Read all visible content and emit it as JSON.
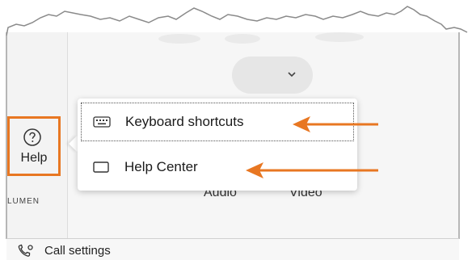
{
  "help_menu": {
    "label": "Help",
    "items": [
      {
        "label": "Keyboard shortcuts",
        "icon": "keyboard-icon"
      },
      {
        "label": "Help Center",
        "icon": "window-icon"
      }
    ]
  },
  "sidebar": {
    "brand_label": "LUMEN"
  },
  "media": {
    "audio_label": "Audio",
    "video_label": "Video"
  },
  "footer": {
    "call_settings_label": "Call settings"
  },
  "colors": {
    "annotation": "#e87722"
  }
}
